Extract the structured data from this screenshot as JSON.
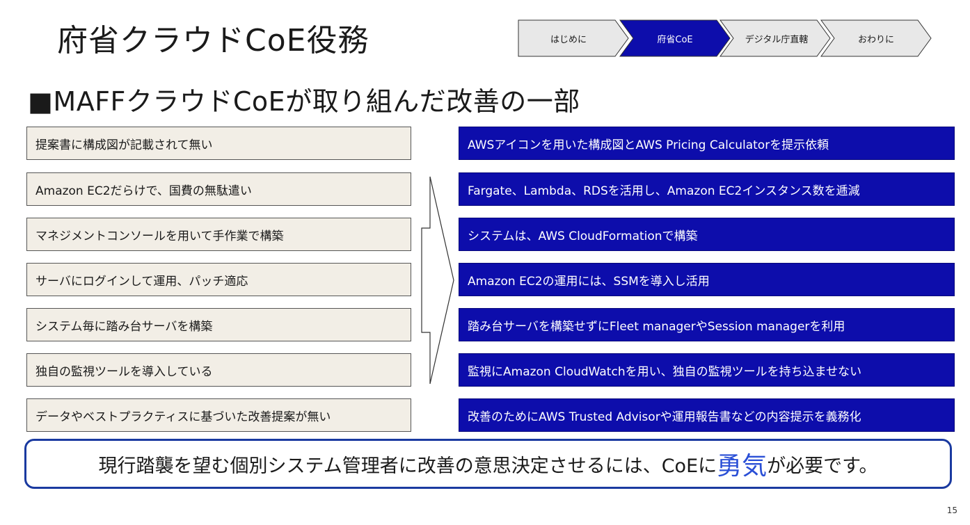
{
  "slide": {
    "title": "府省クラウドCoE役務",
    "subtitle": "■MAFFクラウドCoEが取り組んだ改善の一部",
    "page_number": "15"
  },
  "breadcrumb": {
    "items": [
      {
        "label": "はじめに",
        "active": false
      },
      {
        "label": "府省CoE",
        "active": true
      },
      {
        "label": "デジタル庁直轄",
        "active": false
      },
      {
        "label": "おわりに",
        "active": false
      }
    ]
  },
  "problems": [
    "提案書に構成図が記載されて無い",
    "Amazon EC2だらけで、国費の無駄遣い",
    "マネジメントコンソールを用いて手作業で構築",
    "サーバにログインして運用、パッチ適応",
    "システム毎に踏み台サーバを構築",
    "独自の監視ツールを導入している",
    "データやベストプラクティスに基づいた改善提案が無い"
  ],
  "improvements": [
    "AWSアイコンを用いた構成図とAWS Pricing Calculatorを提示依頼",
    "Fargate、Lambda、RDSを活用し、Amazon EC2インスタンス数を逓減",
    "システムは、AWS CloudFormationで構築",
    "Amazon EC2の運用には、SSMを導入し活用",
    "踏み台サーバを構築せずにFleet managerやSession managerを利用",
    "監視にAmazon CloudWatchを用い、独自の監視ツールを持ち込ませない",
    "改善のためにAWS Trusted Advisorや運用報告書などの内容提示を義務化"
  ],
  "conclusion": {
    "before": "現行踏襲を望む個別システム管理者に改善の意思決定させるには、CoEに",
    "emphasis": "勇気",
    "after": "が必要です。"
  },
  "colors": {
    "crumb_inactive_fill": "#e8e8e8",
    "crumb_active_fill": "#0d0dab",
    "left_box_fill": "#f2eee6",
    "right_box_fill": "#0d0dab",
    "emphasis_text": "#2a4fd6",
    "conclusion_border": "#1a3aa0"
  }
}
